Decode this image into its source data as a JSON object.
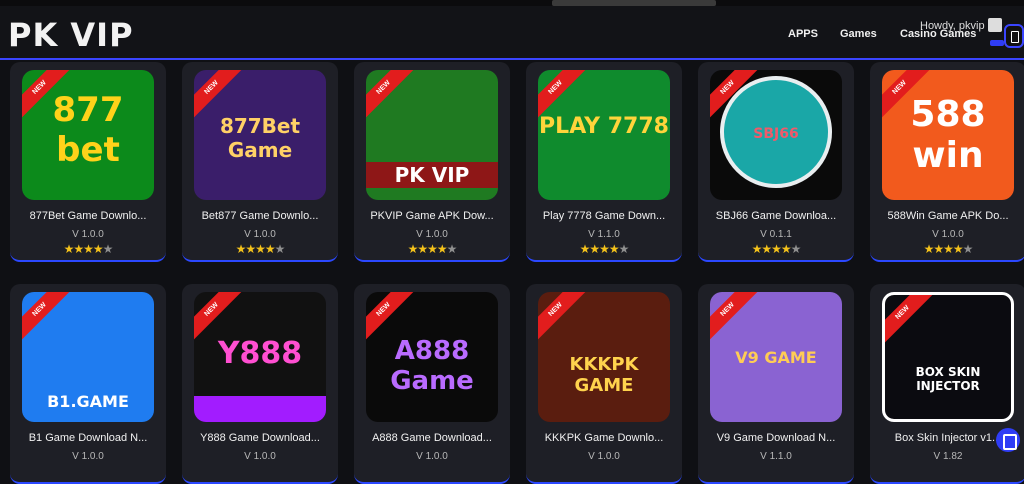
{
  "header": {
    "logo": "PK VIP",
    "nav": [
      "APPS",
      "Games",
      "Casino Games"
    ],
    "user_greeting": "Howdy, pkvip"
  },
  "cards": [
    {
      "title": "877Bet Game Downlo...",
      "version": "V 1.0.0",
      "thumb": "877 bet",
      "rating": 4.5
    },
    {
      "title": "Bet877 Game Downlo...",
      "version": "V 1.0.0",
      "thumb": "877Bet Game",
      "rating": 4.5
    },
    {
      "title": "PKVIP Game APK Dow...",
      "version": "V 1.0.0",
      "thumb": "PK VIP",
      "rating": 4.5
    },
    {
      "title": "Play 7778 Game Down...",
      "version": "V 1.1.0",
      "thumb": "PLAY 7778",
      "rating": 4.5
    },
    {
      "title": "SBJ66 Game Downloa...",
      "version": "V 0.1.1",
      "thumb": "SBJ66",
      "rating": 4.5
    },
    {
      "title": "588Win Game APK Do...",
      "version": "V 1.0.0",
      "thumb": "588 win",
      "rating": 4.5
    },
    {
      "title": "B1 Game Download N...",
      "version": "V 1.0.0",
      "thumb": "B1.GAME",
      "rating": 0
    },
    {
      "title": "Y888 Game Download...",
      "version": "V 1.0.0",
      "thumb": "Y888",
      "rating": 0
    },
    {
      "title": "A888 Game Download...",
      "version": "V 1.0.0",
      "thumb": "A888 Game",
      "rating": 0
    },
    {
      "title": "KKKPK Game Downlo...",
      "version": "V 1.0.0",
      "thumb": "KKKPK GAME",
      "rating": 0
    },
    {
      "title": "V9 Game Download N...",
      "version": "V 1.1.0",
      "thumb": "V9 GAME",
      "rating": 0
    },
    {
      "title": "Box Skin Injector v1...",
      "version": "V 1.82",
      "thumb": "BOX SKIN INJECTOR",
      "rating": 0
    }
  ],
  "badges": {
    "new": "NEW"
  }
}
